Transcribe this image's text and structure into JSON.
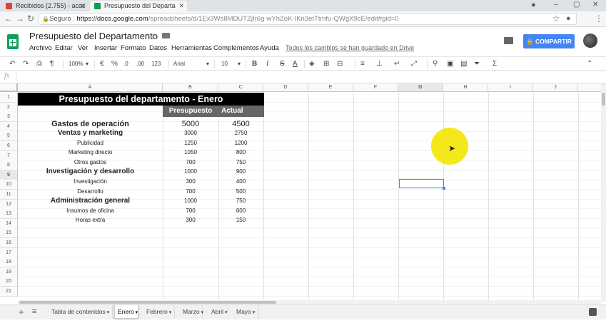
{
  "browser": {
    "tabs": [
      {
        "label": "Recibidos (2.755) - acac"
      },
      {
        "label": "Presupuesto del Departa"
      }
    ],
    "secure_label": "Seguro",
    "url_host": "https://docs.google.com",
    "url_path": "/spreadsheets/d/1Ex3Ws8MDUTZjIr6g-wYhZoK-IKn3etTtmfu-QWgX9cE/edit#gid=0",
    "window_controls": [
      "–",
      "▢",
      "✕"
    ]
  },
  "doc": {
    "title": "Presupuesto del Departamento",
    "menus": [
      "Archivo",
      "Editar",
      "Ver",
      "Insertar",
      "Formato",
      "Datos",
      "Herramientas",
      "Complementos",
      "Ayuda"
    ],
    "save_status": "Todos los cambios se han guardado en Drive",
    "share_label": "COMPARTIR"
  },
  "toolbar": {
    "zoom": "100%",
    "currency": "€",
    "percent": "%",
    "dec_less": ".0",
    "dec_more": ".00",
    "more_formats": "123",
    "font": "Arial",
    "font_size": "10",
    "bold": "B",
    "italic": "I",
    "strike": "S",
    "text_color": "A"
  },
  "formula_bar": {
    "label": "fx",
    "value": ""
  },
  "columns": [
    "A",
    "B",
    "C",
    "D",
    "E",
    "F",
    "G",
    "H",
    "I",
    "J"
  ],
  "selected_column": "G",
  "selected_row": "9",
  "rows": [
    "1",
    "2",
    "3",
    "4",
    "5",
    "6",
    "7",
    "8",
    "9",
    "10",
    "11",
    "12",
    "13",
    "14",
    "15",
    "16",
    "17",
    "18",
    "19",
    "20",
    "21"
  ],
  "sheet": {
    "title": "Presupuesto del departamento - Enero",
    "headers": {
      "budget": "Presupuesto",
      "actual": "Actual"
    },
    "lines": [
      {
        "label": "Gastos de operación",
        "budget": "5000",
        "actual": "4500",
        "style": "big"
      },
      {
        "label": "Ventas y marketing",
        "budget": "3000",
        "actual": "2750",
        "style": "bold"
      },
      {
        "label": "Publicidad",
        "budget": "1250",
        "actual": "1200",
        "style": "normal"
      },
      {
        "label": "Marketing directo",
        "budget": "1050",
        "actual": "800",
        "style": "normal"
      },
      {
        "label": "Otros gastos",
        "budget": "700",
        "actual": "750",
        "style": "normal"
      },
      {
        "label": "Investigación y desarrollo",
        "budget": "1000",
        "actual": "900",
        "style": "bold"
      },
      {
        "label": "Investigación",
        "budget": "300",
        "actual": "400",
        "style": "normal"
      },
      {
        "label": "Desarrollo",
        "budget": "700",
        "actual": "500",
        "style": "normal"
      },
      {
        "label": "Administración general",
        "budget": "1000",
        "actual": "750",
        "style": "bold"
      },
      {
        "label": "Insumos de oficina",
        "budget": "700",
        "actual": "600",
        "style": "normal"
      },
      {
        "label": "Horas extra",
        "budget": "300",
        "actual": "150",
        "style": "normal"
      }
    ]
  },
  "sheet_tabs": [
    {
      "label": "Tabla de contenidos",
      "active": false
    },
    {
      "label": "Enero",
      "active": true
    },
    {
      "label": "Febrero",
      "active": false
    },
    {
      "label": "Marzo",
      "active": false
    },
    {
      "label": "Abril",
      "active": false
    },
    {
      "label": "Mayo",
      "active": false
    }
  ],
  "colors": {
    "share": "#4285f4",
    "sheets_green": "#0f9d58",
    "title_bg": "#000000",
    "header_bg": "#666666",
    "selection": "#4285f4",
    "cursor_highlight": "#f4e600"
  }
}
